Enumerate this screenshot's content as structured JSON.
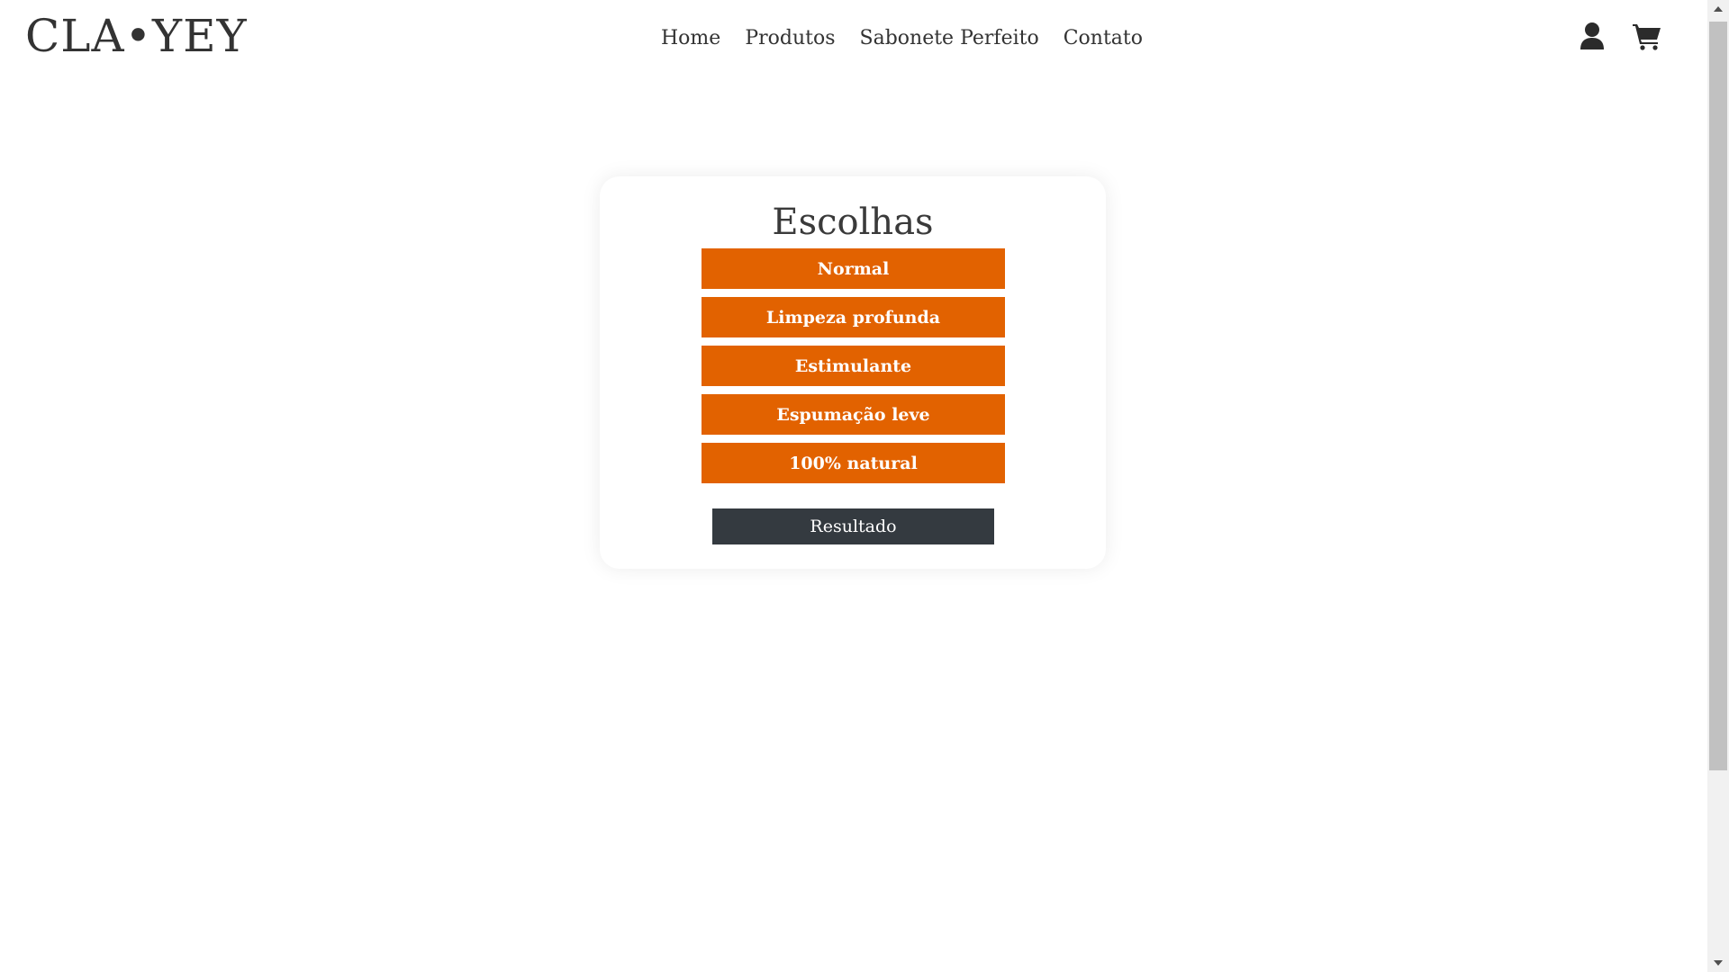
{
  "header": {
    "logo": "CLA•YEY",
    "nav": [
      {
        "label": "Home"
      },
      {
        "label": "Produtos"
      },
      {
        "label": "Sabonete Perfeito"
      },
      {
        "label": "Contato"
      }
    ],
    "icons": [
      "user-icon",
      "cart-icon"
    ]
  },
  "card": {
    "title": "Escolhas",
    "choices": [
      {
        "label": "Normal"
      },
      {
        "label": "Limpeza profunda"
      },
      {
        "label": "Estimulante"
      },
      {
        "label": "Espumação leve"
      },
      {
        "label": "100% natural"
      }
    ],
    "result_label": "Resultado"
  },
  "colors": {
    "accent": "#e26200",
    "dark_button": "#343a40",
    "text": "#333333"
  }
}
